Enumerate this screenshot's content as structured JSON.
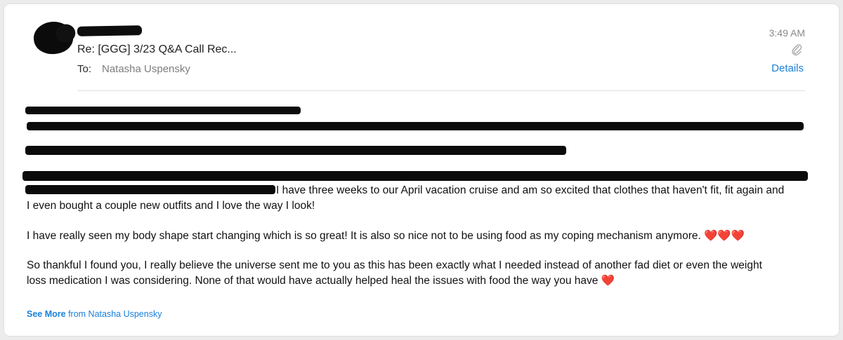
{
  "header": {
    "subject": "Re: [GGG] 3/23 Q&A Call Rec...",
    "to_label": "To:",
    "to_name": "Natasha Uspensky",
    "time": "3:49 AM",
    "details_label": "Details",
    "attachment_icon": "paperclip-icon"
  },
  "message": {
    "line1_tail": "I have three weeks to our April vacation cruise and am so excited that clothes that haven't fit, fit again and",
    "line2": "I even bought a couple new outfits and I love the way I look!",
    "para2": "I have really seen my body shape start changing which is so great! It is also so nice not to be using food as my coping mechanism anymore.",
    "para2_emoji": "❤️❤️❤️",
    "para3_line1": "So thankful I found you, I really believe the universe sent me to you as this has been exactly what I needed instead of another fad diet or even the weight",
    "para3_line2": "loss medication I was considering. None of that would have actually helped heal the issues with food the way you have",
    "para3_emoji": "❤️"
  },
  "footer": {
    "see_more_bold": "See More",
    "see_more_rest": "from Natasha Uspensky"
  },
  "colors": {
    "link": "#1a80d9",
    "redaction": "#0b0b0b"
  }
}
